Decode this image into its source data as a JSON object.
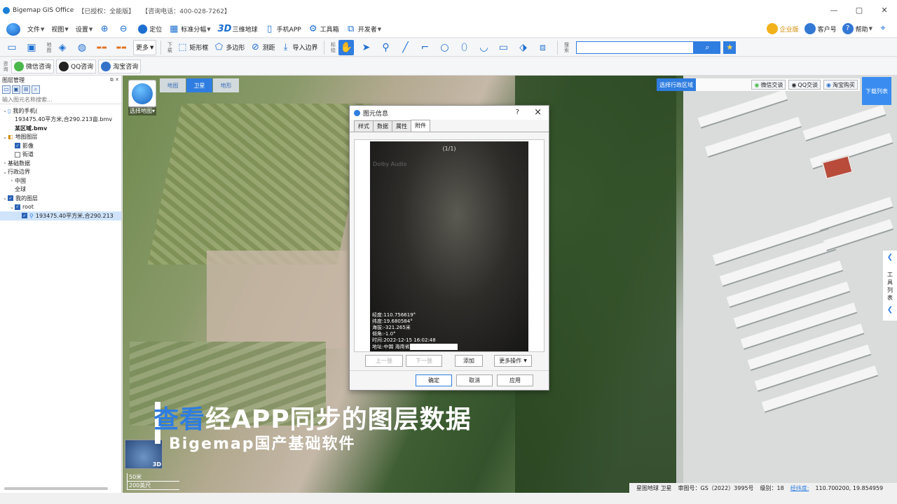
{
  "app": {
    "title": "Bigemap GIS Office",
    "license": "【已授权：全能版】",
    "phone": "【咨询电话：400-028-7262】"
  },
  "menu": {
    "items": [
      {
        "label": "文件",
        "icon": ""
      },
      {
        "label": "视图",
        "icon": ""
      },
      {
        "label": "设置",
        "icon": ""
      }
    ],
    "zoom_in": "zoom-in",
    "zoom_out": "zoom-out",
    "locate": "定位",
    "grid": "标准分幅",
    "three_d": "三维地球",
    "mobile": "手机APP",
    "toolbox": "工具箱",
    "developer": "开发者",
    "right": [
      "企业版",
      "客户号",
      "帮助"
    ]
  },
  "toolbar": {
    "vlabels": [
      "地图",
      "下载",
      "标绘",
      "搜索"
    ],
    "more": "更多",
    "rect": "矩形框",
    "polygon": "多边形",
    "measure": "测距",
    "import_boundary": "导入边界"
  },
  "toolbar3": {
    "vlabel": "咨询",
    "wechat": "微信咨询",
    "qq": "QQ咨询",
    "taobao": "淘宝咨询"
  },
  "layers": {
    "title": "图层管理",
    "search_placeholder": "输入图元名称搜索...",
    "rows": [
      {
        "text": "我的手机(",
        "level": 0,
        "arrow": "v",
        "checkbox": "none",
        "icon": "phone"
      },
      {
        "text": "193475.40平方米,合290.213亩.bmv",
        "level": 1,
        "arrow": "",
        "checkbox": "none",
        "icon": ""
      },
      {
        "text": "某区域.bmv",
        "level": 1,
        "arrow": "",
        "checkbox": "none",
        "icon": "",
        "bold": true
      },
      {
        "text": "地图图层",
        "level": 0,
        "arrow": "v",
        "checkbox": "none",
        "icon": "layers"
      },
      {
        "text": "影像",
        "level": 1,
        "arrow": "",
        "checkbox": "on",
        "icon": ""
      },
      {
        "text": "街道",
        "level": 1,
        "arrow": "",
        "checkbox": "off",
        "icon": ""
      },
      {
        "text": "基础数据",
        "level": 0,
        "arrow": ">",
        "checkbox": "none",
        "icon": ""
      },
      {
        "text": "行政边界",
        "level": 0,
        "arrow": "v",
        "checkbox": "none",
        "icon": ""
      },
      {
        "text": "中国",
        "level": 1,
        "arrow": ">",
        "checkbox": "none",
        "icon": ""
      },
      {
        "text": "全球",
        "level": 1,
        "arrow": "",
        "checkbox": "none",
        "icon": ""
      },
      {
        "text": "我的图层",
        "level": 0,
        "arrow": "v",
        "checkbox": "on",
        "icon": ""
      },
      {
        "text": "root",
        "level": 1,
        "arrow": "v",
        "checkbox": "on",
        "icon": ""
      },
      {
        "text": "193475.40平方米,合290.213",
        "level": 2,
        "arrow": "",
        "checkbox": "on",
        "icon": "pin",
        "selected": true
      }
    ]
  },
  "map": {
    "tabs": [
      "地图",
      "卫星",
      "地形"
    ],
    "active_tab": 1,
    "selector_label": "选择地图",
    "region_label": "选择行政区域",
    "region_buttons": [
      "微信交谈",
      "QQ交谈",
      "淘宝购买"
    ],
    "download_list": "下载列表",
    "side_tools": "工具列表",
    "mini_3d": "3D",
    "scale_top": "50米",
    "scale_bottom": "200英尺",
    "caption_highlight": "查看",
    "caption_rest": "经APP同步的图层数据",
    "caption_sub": "Bigemap国产基础软件"
  },
  "status": {
    "source": "星图地球 卫星",
    "review": "审图号：GS（2022）3995号",
    "level": "级别：18",
    "coord_label": "经纬度:",
    "coord_value": "110.700200, 19.854959"
  },
  "dialog": {
    "title": "图元信息",
    "help": "?",
    "close": "×",
    "tabs": [
      "样式",
      "数据",
      "属性",
      "附件"
    ],
    "active_tab": 3,
    "counter": "(1/1)",
    "watermark": "Dolby Audio",
    "meta": [
      "经度:110.756619°",
      "纬度:19.680584°",
      "海拔:-321.265米",
      "倾角:-1.0°",
      "时间:2022-12-15 16:02:48",
      "地址:中国 海南省"
    ],
    "prev": "上一张",
    "next": "下一张",
    "add": "添加",
    "more_ops": "更多操作",
    "ok": "确定",
    "cancel": "取消",
    "apply": "应用"
  },
  "colors": {
    "accent": "#2f7de0"
  }
}
